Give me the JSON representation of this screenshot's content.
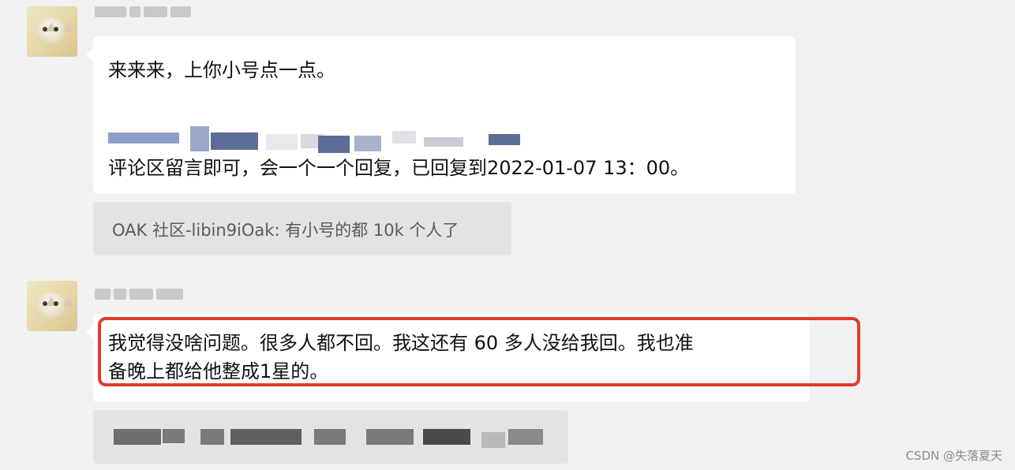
{
  "messages": [
    {
      "sender": "",
      "lines": [
        "来来来，上你小号点一点。",
        "评论区留言即可，会一个一个回复，已回复到2022-01-07 13：00。"
      ],
      "quote": "OAK 社区-libin9iOak: 有小号的都 10k 个人了"
    },
    {
      "sender": "",
      "lines": [
        "我觉得没啥问题。很多人都不回。我这还有 60 多人没给我回。我也准",
        "备晚上都给他整成1星的。"
      ],
      "quote": ""
    }
  ],
  "watermark": "CSDN @失落夏天",
  "colors": {
    "background": "#f1f1f1",
    "bubble": "#ffffff",
    "quote": "#e3e3e3",
    "highlight": "#e13b2b"
  }
}
